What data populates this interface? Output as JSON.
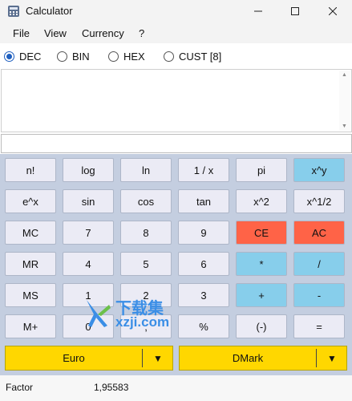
{
  "window": {
    "title": "Calculator"
  },
  "menu": [
    "File",
    "View",
    "Currency",
    "?"
  ],
  "modes": [
    {
      "label": "DEC",
      "selected": true
    },
    {
      "label": "BIN",
      "selected": false
    },
    {
      "label": "HEX",
      "selected": false
    },
    {
      "label": "CUST [8]",
      "selected": false
    }
  ],
  "display": {
    "text": ""
  },
  "entry": {
    "value": ""
  },
  "keys": [
    [
      "n!",
      "log",
      "ln",
      "1 / x",
      "pi",
      "x^y"
    ],
    [
      "e^x",
      "sin",
      "cos",
      "tan",
      "x^2",
      "x^1/2"
    ],
    [
      "MC",
      "7",
      "8",
      "9",
      "CE",
      "AC"
    ],
    [
      "MR",
      "4",
      "5",
      "6",
      "*",
      "/"
    ],
    [
      "MS",
      "1",
      "2",
      "3",
      "+",
      "-"
    ],
    [
      "M+",
      "0",
      ",",
      "%",
      "(-)",
      "="
    ]
  ],
  "key_colors": {
    "default": "#ebebf5",
    "red": "#ff6347",
    "blue": "#87ceeb"
  },
  "currency": {
    "from": "Euro",
    "to": "DMark",
    "color": "#ffd700"
  },
  "status": {
    "label": "Factor",
    "value": "1,95583"
  },
  "watermark": {
    "text": "下载集",
    "url": "xzji.com"
  }
}
